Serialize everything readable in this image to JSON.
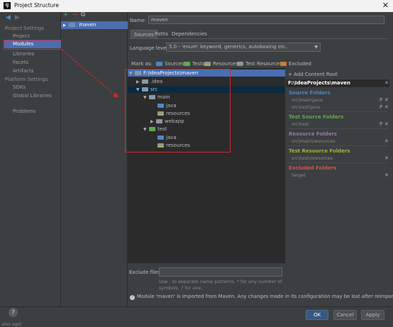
{
  "window": {
    "title": "Project Structure",
    "close_glyph": "✕"
  },
  "nav": {
    "back": "◀",
    "forward": "▶"
  },
  "left": {
    "project_settings": "Project Settings",
    "project": "Project",
    "modules": "Modules",
    "libraries": "Libraries",
    "facets": "Facets",
    "artifacts": "Artifacts",
    "platform_settings": "Platform Settings",
    "sdks": "SDKs",
    "global_libraries": "Global Libraries",
    "problems": "Problems"
  },
  "middle": {
    "add": "+",
    "remove": "−",
    "copy": "⧉",
    "module_name": "maven"
  },
  "name": {
    "label": "Name:",
    "value": "maven"
  },
  "tabs": [
    "Sources",
    "Paths",
    "Dependencies"
  ],
  "language": {
    "label": "Language level:",
    "value": "5.0 - 'enum' keyword, generics, autoboxing etc."
  },
  "mark": {
    "label": "Mark as:",
    "sources": "Sources",
    "tests": "Tests",
    "resources": "Resources",
    "test_resources": "Test Resources",
    "excluded": "Excluded"
  },
  "tree": {
    "root": "F:\\IdeaProjects\\maven",
    "idea": ".idea",
    "src": "src",
    "main": "main",
    "java": "java",
    "resources": "resources",
    "webapp": "webapp",
    "test": "test",
    "test_java": "java",
    "test_resources": "resources"
  },
  "content": {
    "add_root": "+ Add Content Root",
    "root_path": "F:\\IdeaProjects\\maven",
    "source_folders": "Source Folders",
    "sf1": "src\\main\\java",
    "sf2": "src\\test\\java",
    "test_source_folders": "Test Source Folders",
    "tsf1": "src\\test",
    "resource_folders": "Resource Folders",
    "rf1": "src\\main\\resources",
    "test_resource_folders": "Test Resource Folders",
    "trf1": "src\\test\\resources",
    "excluded_folders": "Excluded Folders",
    "ef1": "target"
  },
  "excludes": {
    "label": "Exclude files:",
    "hint": "Use ; to separate name patterns, * for any number of symbols, ? for one."
  },
  "info": "Module 'maven' is imported from Maven. Any changes made in its configuration may be lost after reimporting.",
  "buttons": {
    "ok": "OK",
    "cancel": "Cancel",
    "apply": "Apply",
    "help": "?"
  },
  "status": "utes ago)",
  "colors": {
    "accent": "#4b6eaf",
    "source": "#4a88c7",
    "test": "#62a94a",
    "resource": "#9876aa",
    "test_resource": "#a8b03a",
    "excluded": "#d75050",
    "highlight": "#d9262c"
  }
}
